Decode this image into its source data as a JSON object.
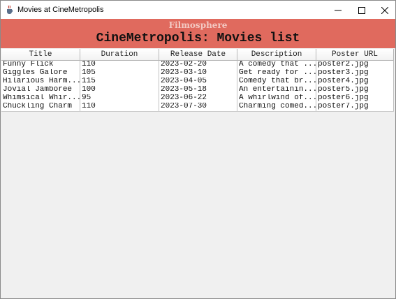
{
  "window": {
    "title": "Movies at CineMetropolis",
    "controls": {
      "minimize_glyph": "─",
      "maximize_glyph": "□",
      "close_glyph": "✕"
    }
  },
  "header": {
    "brand": "Filmosphere",
    "title": "CineMetropolis: Movies list"
  },
  "table": {
    "columns": [
      "Title",
      "Duration",
      "Release Date",
      "Description",
      "Poster URL"
    ],
    "rows": [
      [
        "Funny Flick",
        "110",
        "2023-02-20",
        "A comedy that ...",
        "poster2.jpg"
      ],
      [
        "Giggles Galore",
        "105",
        "2023-03-10",
        "Get ready for ...",
        "poster3.jpg"
      ],
      [
        "Hilarious Harm...",
        "115",
        "2023-04-05",
        "Comedy that br...",
        "poster4.jpg"
      ],
      [
        "Jovial Jamboree",
        "100",
        "2023-05-18",
        "An entertainin...",
        "poster5.jpg"
      ],
      [
        "Whimsical Whir...",
        "95",
        "2023-06-22",
        "A whirlwind of...",
        "poster6.jpg"
      ],
      [
        "Chuckling Charm",
        "110",
        "2023-07-30",
        "Charming comed...",
        "poster7.jpg"
      ]
    ]
  },
  "colors": {
    "header_bg": "#e06a5e",
    "brand_text": "#f3c9c3",
    "window_bg": "#f0f0f0"
  },
  "icons": {
    "app": "java-cup-icon"
  }
}
